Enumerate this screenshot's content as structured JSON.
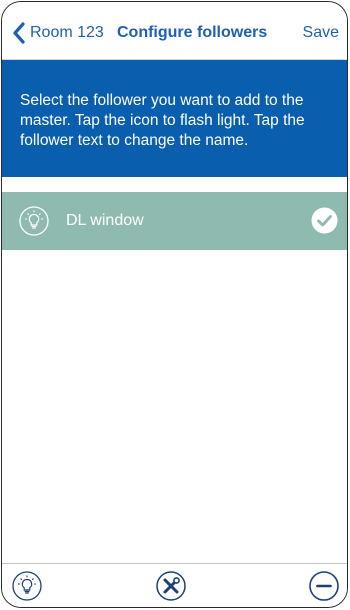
{
  "navbar": {
    "back_label": "Room 123",
    "title": "Configure followers",
    "save_label": "Save"
  },
  "info": {
    "text": "Select the follower you want to add to the master. Tap the icon to flash light. Tap the follower text to change the name."
  },
  "followers": [
    {
      "label": "DL window",
      "icon": "bulb-icon",
      "selected": true
    }
  ],
  "toolbar": {
    "icons": [
      "bulb-icon",
      "wrench-icon",
      "minus-icon"
    ]
  },
  "colors": {
    "accent": "#1f5fb5",
    "info_bg": "#0a5eae",
    "row_selected": "#8fbab0"
  }
}
